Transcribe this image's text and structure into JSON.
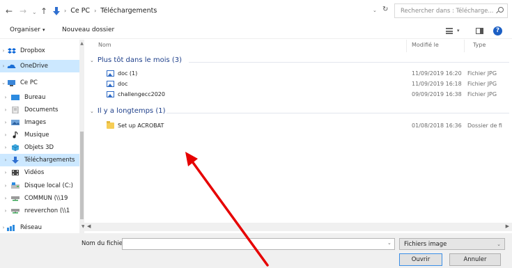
{
  "address_bar": {
    "path": [
      "Ce PC",
      "Téléchargements"
    ],
    "search_placeholder": "Rechercher dans : Télécharge..."
  },
  "toolbar": {
    "organise_label": "Organiser",
    "new_folder_label": "Nouveau dossier"
  },
  "nav_pane": {
    "items": [
      {
        "label": "Dropbox",
        "icon": "dropbox-icon"
      },
      {
        "label": "OneDrive",
        "icon": "onedrive-icon",
        "selected": true
      },
      {
        "label": "Ce PC",
        "icon": "computer-icon"
      },
      {
        "label": "Bureau",
        "icon": "desktop-folder-icon"
      },
      {
        "label": "Documents",
        "icon": "documents-folder-icon"
      },
      {
        "label": "Images",
        "icon": "images-folder-icon"
      },
      {
        "label": "Musique",
        "icon": "music-icon"
      },
      {
        "label": "Objets 3D",
        "icon": "objects-3d-icon"
      },
      {
        "label": "Téléchargements",
        "icon": "downloads-icon",
        "selected": true
      },
      {
        "label": "Vidéos",
        "icon": "videos-folder-icon"
      },
      {
        "label": "Disque local (C:)",
        "icon": "drive-icon"
      },
      {
        "label": "COMMUN (\\\\19",
        "icon": "network-drive-icon"
      },
      {
        "label": "nreverchon (\\\\1",
        "icon": "network-drive-icon"
      },
      {
        "label": "Réseau",
        "icon": "network-icon"
      }
    ]
  },
  "file_list": {
    "columns": [
      "Nom",
      "Modifié le",
      "Type"
    ],
    "groups": [
      {
        "header": "Plus tôt dans le mois (3)",
        "files": [
          {
            "name": "doc (1)",
            "modified": "11/09/2019 16:20",
            "type": "Fichier JPG",
            "icon": "image-file-icon"
          },
          {
            "name": "doc",
            "modified": "11/09/2019 16:18",
            "type": "Fichier JPG",
            "icon": "image-file-icon"
          },
          {
            "name": "challengecc2020",
            "modified": "09/09/2019 16:38",
            "type": "Fichier JPG",
            "icon": "image-file-icon"
          }
        ]
      },
      {
        "header": "Il y a longtemps (1)",
        "files": [
          {
            "name": "Set up ACROBAT",
            "modified": "01/08/2018 16:36",
            "type": "Dossier de fi",
            "icon": "folder-icon"
          }
        ]
      }
    ]
  },
  "bottom": {
    "filename_label": "Nom du fichier :",
    "filename_value": "",
    "filetype_value": "Fichiers image",
    "open_label": "Ouvrir",
    "cancel_label": "Annuler"
  },
  "colors": {
    "selection": "#cce8ff",
    "group_header": "#1e3f8a",
    "annotation_arrow": "#e60000"
  }
}
